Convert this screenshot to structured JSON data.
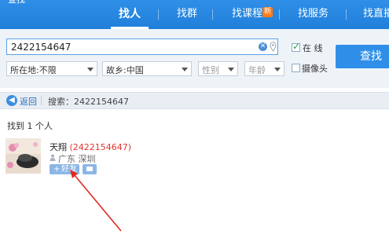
{
  "app": {
    "title": "查找"
  },
  "tabs": [
    {
      "label": "找人",
      "active": true
    },
    {
      "label": "找群",
      "active": false
    },
    {
      "label": "找课程",
      "active": false,
      "badge": "新"
    },
    {
      "label": "找服务",
      "active": false
    },
    {
      "label": "找直播",
      "active": false
    }
  ],
  "search": {
    "value": "2422154647"
  },
  "filters": {
    "location": "所在地:不限",
    "hometown": "故乡:中国",
    "gender": "性别",
    "age": "年龄"
  },
  "options": {
    "online": {
      "label": "在 线",
      "checked": true
    },
    "camera": {
      "label": "摄像头",
      "checked": false
    }
  },
  "search_button": "查找",
  "breadcrumb": {
    "back": "返回",
    "query": "搜索：2422154647"
  },
  "results": {
    "count_text": "找到 1 个人",
    "items": [
      {
        "name": "天翔",
        "number": "(2422154647)",
        "location": "广东 深圳",
        "add_label": "好友",
        "add_icon": "+"
      }
    ]
  },
  "colors": {
    "accent": "#2f8fe8",
    "number": "#e0342e",
    "arrow": "#e02a1f"
  }
}
